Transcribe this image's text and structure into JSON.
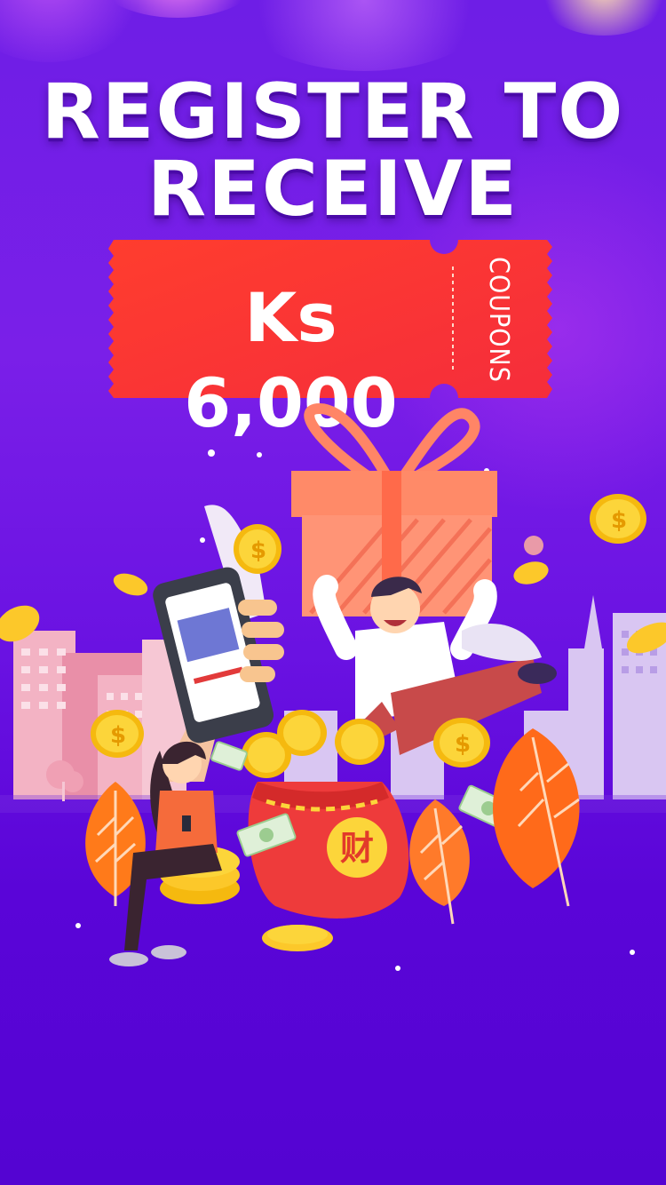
{
  "headline": {
    "line1": "REGISTER TO",
    "line2": "RECEIVE"
  },
  "coupon": {
    "amount": "Ks 6,000",
    "label": "COUPONS"
  },
  "illustration": {
    "bag_character": "财"
  },
  "colors": {
    "background_top": "#7a1fe8",
    "background_bottom": "#5404d2",
    "ticket_red": "#ff3b30",
    "coin_gold": "#f7c21e",
    "leaf_orange": "#ff7a1a"
  }
}
